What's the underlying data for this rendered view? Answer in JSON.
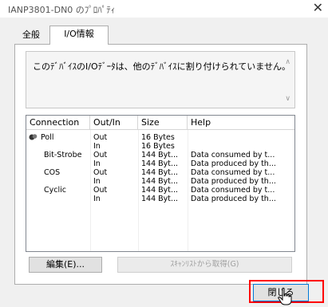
{
  "window": {
    "title": "IANP3801-DN0 のﾌﾟﾛﾊﾟﾃｨ",
    "close_glyph": "✕"
  },
  "tabs": [
    {
      "label": "全般",
      "active": false
    },
    {
      "label": "I/O情報",
      "active": true
    }
  ],
  "message": {
    "text": "このﾃﾞﾊﾞｲｽのI/Oﾃﾞｰﾀは、他のﾃﾞﾊﾞｲｽに割り付けられていません。",
    "scroll_up": "∧",
    "scroll_down": "∨"
  },
  "table": {
    "columns": [
      "Connection",
      "Out/In",
      "Size",
      "Help"
    ],
    "rows": [
      {
        "connection": "Poll",
        "direction": "Out",
        "size": "16 Bytes",
        "help": ""
      },
      {
        "connection": "",
        "direction": "In",
        "size": "16 Bytes",
        "help": ""
      },
      {
        "connection": "Bit-Strobe",
        "direction": "Out",
        "size": "144 Byt...",
        "help": "Data consumed by t..."
      },
      {
        "connection": "",
        "direction": "In",
        "size": "144 Byt...",
        "help": "Data produced by th..."
      },
      {
        "connection": "COS",
        "direction": "Out",
        "size": "144 Byt...",
        "help": "Data consumed by t..."
      },
      {
        "connection": "",
        "direction": "In",
        "size": "144 Byt...",
        "help": "Data produced by th..."
      },
      {
        "connection": "Cyclic",
        "direction": "Out",
        "size": "144 Byt...",
        "help": "Data consumed by t..."
      },
      {
        "connection": "",
        "direction": "In",
        "size": "144 Byt...",
        "help": "Data produced by th..."
      }
    ]
  },
  "buttons": {
    "edit": "編集(E)...",
    "get_from_scanlist": "ｽｷｬﾝﾘｽﾄから取得(G)",
    "close": "閉じる"
  },
  "colors": {
    "highlight": "#ff0000",
    "focus": "#0078d7"
  }
}
